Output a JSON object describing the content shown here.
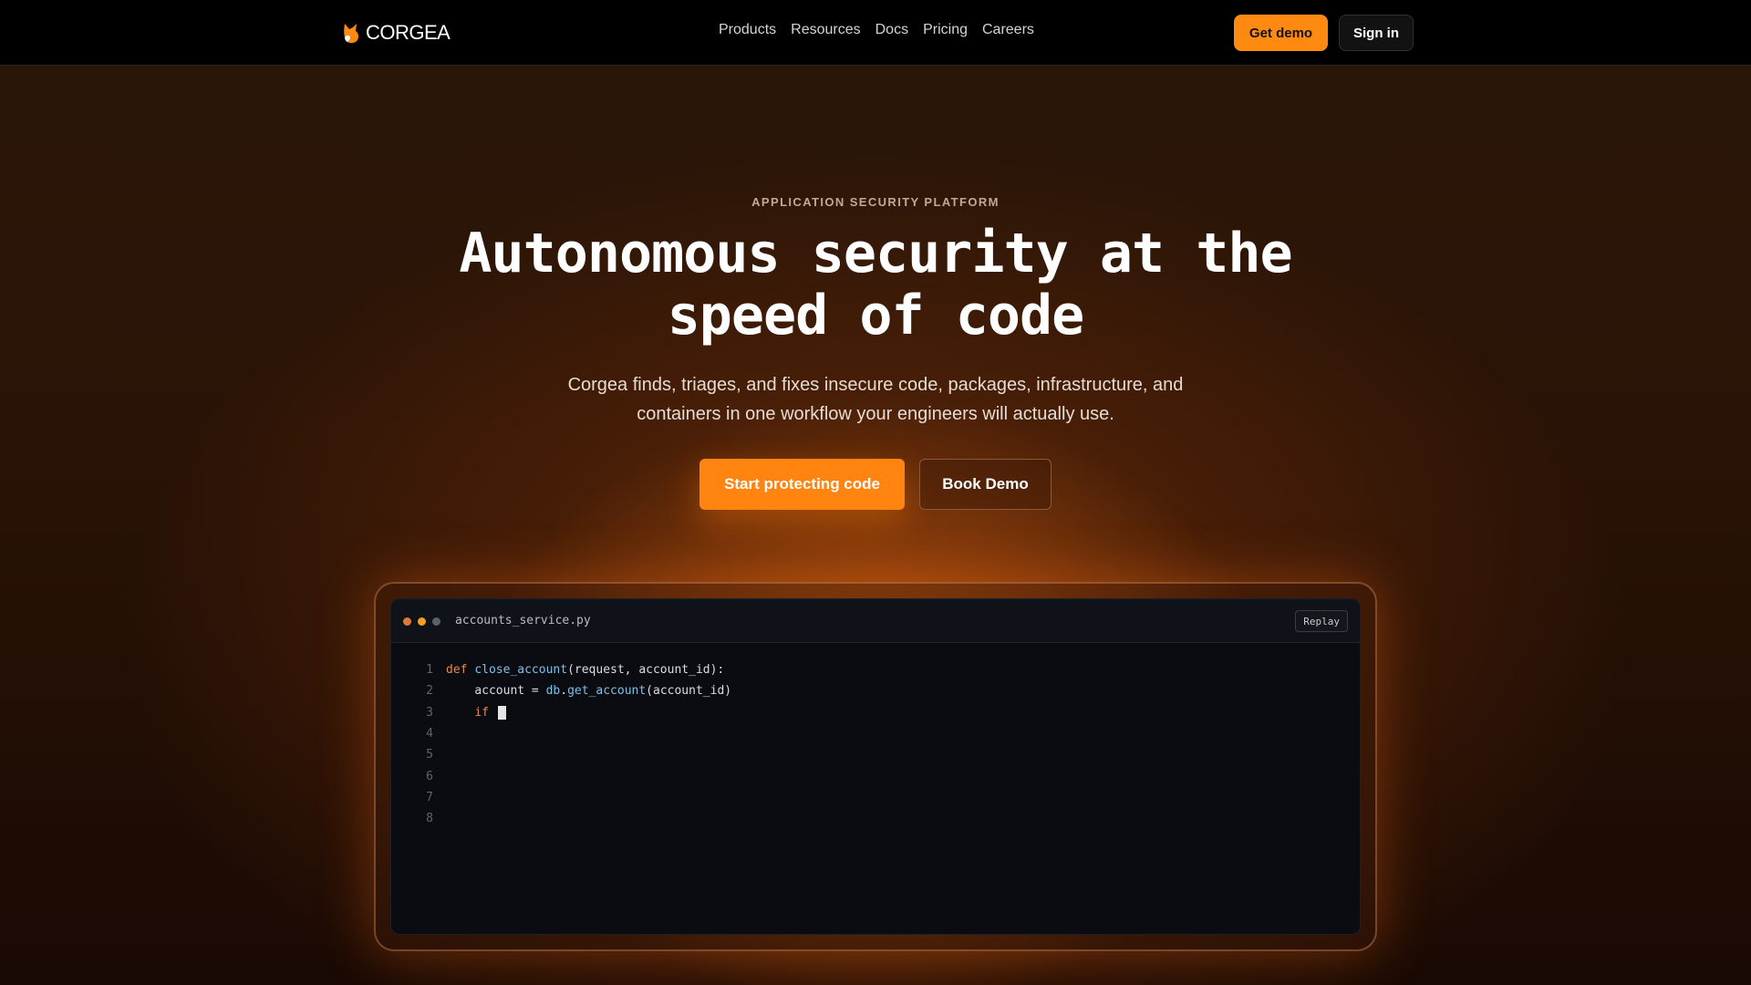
{
  "nav": {
    "logo_text": "CORGEA",
    "links": [
      "Products",
      "Resources",
      "Docs",
      "Pricing",
      "Careers"
    ],
    "get_demo": "Get demo",
    "sign_in": "Sign in"
  },
  "hero": {
    "eyebrow": "APPLICATION SECURITY PLATFORM",
    "headline_line1": "Autonomous security at the",
    "headline_line2": "speed of code",
    "subtitle_line1": "Corgea finds, triages, and fixes insecure code, packages, infrastructure, and",
    "subtitle_line2": "containers in one workflow your engineers will actually use.",
    "primary_cta": "Start protecting code",
    "secondary_cta": "Book Demo"
  },
  "editor": {
    "filename": "accounts_service.py",
    "replay": "Replay",
    "line_numbers": [
      "1",
      "2",
      "3",
      "4",
      "5",
      "6",
      "7",
      "8"
    ],
    "line1": {
      "kw": "def",
      "fn": "close_account",
      "rest": "(request, account_id):"
    },
    "line2": {
      "indent": "    ",
      "var": "account = ",
      "obj": "db",
      "dot": ".",
      "fn": "get_account",
      "rest": "(account_id)"
    },
    "line3": {
      "indent": "    ",
      "kw": "if"
    }
  },
  "colors": {
    "accent": "#ff8a12",
    "keyword": "#e8894a",
    "function": "#7dc0e6"
  }
}
